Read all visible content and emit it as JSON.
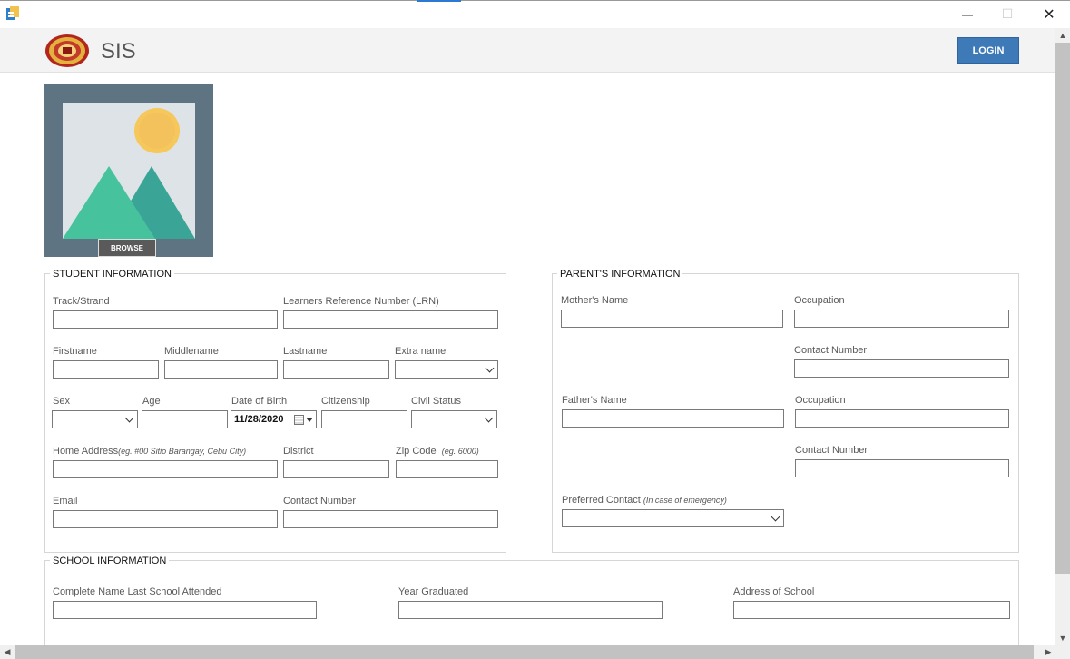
{
  "window": {
    "minimize_glyph": "—",
    "maximize_glyph": "☐",
    "close_glyph": "✕"
  },
  "header": {
    "title": "SIS",
    "login_label": "LOGIN"
  },
  "photo": {
    "browse_label": "BROWSE"
  },
  "student": {
    "legend": "STUDENT INFORMATION",
    "track_label": "Track/Strand",
    "lrn_label": "Learners Reference Number (LRN)",
    "firstname_label": "Firstname",
    "middlename_label": "Middlename",
    "lastname_label": "Lastname",
    "extraname_label": "Extra name",
    "sex_label": "Sex",
    "age_label": "Age",
    "dob_label": "Date of Birth",
    "dob_value": "11/28/2020",
    "citizenship_label": "Citizenship",
    "civil_label": "Civil Status",
    "address_label": "Home Address",
    "address_hint": "(eg. #00 Sitio Barangay, Cebu City)",
    "district_label": "District",
    "zip_label": "Zip Code",
    "zip_hint": "(eg. 6000)",
    "email_label": "Email",
    "contact_label": "Contact Number"
  },
  "parent": {
    "legend": "PARENT'S INFORMATION",
    "mother_label": "Mother's Name",
    "mother_occ_label": "Occupation",
    "mother_contact_label": "Contact Number",
    "father_label": "Father's Name",
    "father_occ_label": "Occupation",
    "father_contact_label": "Contact Number",
    "preferred_label": "Preferred Contact",
    "preferred_hint": "(In case of emergency)"
  },
  "school": {
    "legend": "SCHOOL INFORMATION",
    "name_label": "Complete Name Last School Attended",
    "year_label": "Year Graduated",
    "address_label": "Address of School"
  },
  "scroll": {
    "up": "▲",
    "down": "▼",
    "left": "◀",
    "right": "▶"
  },
  "colors": {
    "accent": "#3d7ab7",
    "photo_frame": "#5f7482",
    "sun": "#f6c75a",
    "mountain_left": "#46c39d",
    "mountain_right": "#3aa596"
  }
}
